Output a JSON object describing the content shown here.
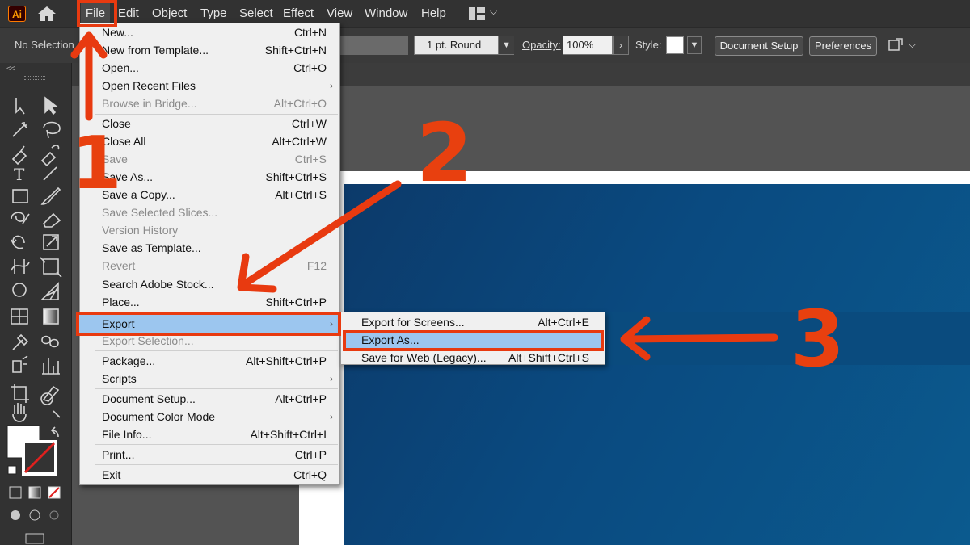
{
  "app": {
    "logo_text": "Ai"
  },
  "menubar": {
    "items": [
      "File",
      "Edit",
      "Object",
      "Type",
      "Select",
      "Effect",
      "View",
      "Window",
      "Help"
    ]
  },
  "controlbar": {
    "selection_text": "No Selection",
    "stroke_value": "1 pt. Round",
    "opacity_label": "Opacity:",
    "opacity_value": "100%",
    "style_label": "Style:",
    "document_setup_label": "Document Setup",
    "preferences_label": "Preferences"
  },
  "file_menu": {
    "items": [
      {
        "label": "New...",
        "shortcut": "Ctrl+N",
        "disabled": false
      },
      {
        "label": "New from Template...",
        "shortcut": "Shift+Ctrl+N",
        "disabled": false
      },
      {
        "label": "Open...",
        "shortcut": "Ctrl+O",
        "disabled": false
      },
      {
        "label": "Open Recent Files",
        "shortcut": "",
        "disabled": false,
        "submenu": true
      },
      {
        "label": "Browse in Bridge...",
        "shortcut": "Alt+Ctrl+O",
        "disabled": true
      },
      {
        "label": "Close",
        "shortcut": "Ctrl+W",
        "disabled": false
      },
      {
        "label": "Close All",
        "shortcut": "Alt+Ctrl+W",
        "disabled": false
      },
      {
        "label": "Save",
        "shortcut": "Ctrl+S",
        "disabled": true
      },
      {
        "label": "Save As...",
        "shortcut": "Shift+Ctrl+S",
        "disabled": false
      },
      {
        "label": "Save a Copy...",
        "shortcut": "Alt+Ctrl+S",
        "disabled": false
      },
      {
        "label": "Save Selected Slices...",
        "shortcut": "",
        "disabled": true
      },
      {
        "label": "Version History",
        "shortcut": "",
        "disabled": true
      },
      {
        "label": "Save as Template...",
        "shortcut": "",
        "disabled": false
      },
      {
        "label": "Revert",
        "shortcut": "F12",
        "disabled": true
      },
      {
        "label": "Search Adobe Stock...",
        "shortcut": "",
        "disabled": false
      },
      {
        "label": "Place...",
        "shortcut": "Shift+Ctrl+P",
        "disabled": false
      },
      {
        "label": "Export",
        "shortcut": "",
        "disabled": false,
        "submenu": true,
        "highlighted": true
      },
      {
        "label": "Export Selection...",
        "shortcut": "",
        "disabled": true
      },
      {
        "label": "Package...",
        "shortcut": "Alt+Shift+Ctrl+P",
        "disabled": false
      },
      {
        "label": "Scripts",
        "shortcut": "",
        "disabled": false,
        "submenu": true
      },
      {
        "label": "Document Setup...",
        "shortcut": "Alt+Ctrl+P",
        "disabled": false
      },
      {
        "label": "Document Color Mode",
        "shortcut": "",
        "disabled": false,
        "submenu": true
      },
      {
        "label": "File Info...",
        "shortcut": "Alt+Shift+Ctrl+I",
        "disabled": false
      },
      {
        "label": "Print...",
        "shortcut": "Ctrl+P",
        "disabled": false
      },
      {
        "label": "Exit",
        "shortcut": "Ctrl+Q",
        "disabled": false
      }
    ]
  },
  "export_submenu": {
    "items": [
      {
        "label": "Export for Screens...",
        "shortcut": "Alt+Ctrl+E",
        "highlighted": false
      },
      {
        "label": "Export As...",
        "shortcut": "",
        "highlighted": true
      },
      {
        "label": "Save for Web (Legacy)...",
        "shortcut": "Alt+Shift+Ctrl+S",
        "highlighted": false
      }
    ]
  },
  "annotations": {
    "step1": "1",
    "step2": "2",
    "step3": "3",
    "color": "#e83a10"
  },
  "colors": {
    "menu_highlight": "#9cc6ef",
    "ui_dark": "#323232",
    "artwork_blue": "#0a4a80"
  }
}
